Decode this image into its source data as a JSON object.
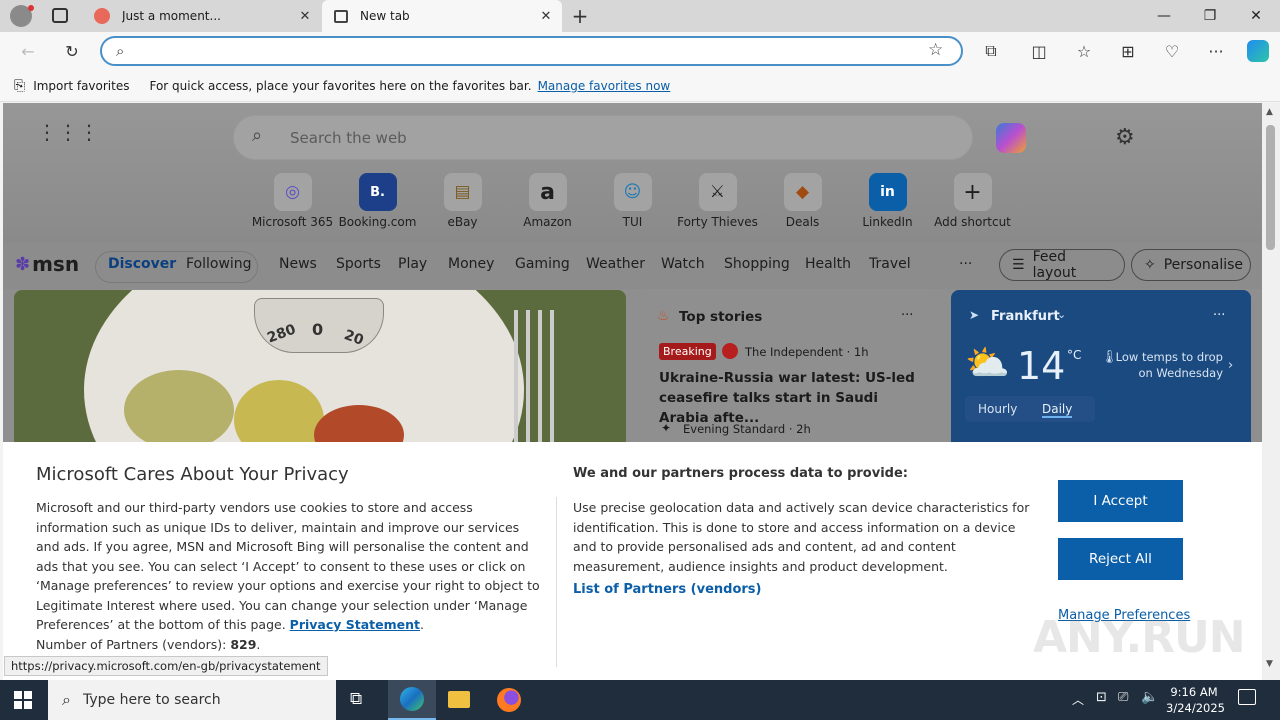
{
  "browser": {
    "tabs": [
      {
        "label": "Just a moment...",
        "active": false
      },
      {
        "label": "New tab",
        "active": true
      }
    ],
    "address_value": "",
    "favorites_bar": {
      "import_label": "Import favorites",
      "hint": "For quick access, place your favorites here on the favorites bar.",
      "manage_link": "Manage favorites now"
    }
  },
  "newtab": {
    "search_placeholder": "Search the web",
    "shortcuts": [
      {
        "label": "Microsoft 365",
        "glyph": "◎",
        "color": "#6b5bd6"
      },
      {
        "label": "Booking.com",
        "glyph": "B.",
        "color": "#1d3f8a"
      },
      {
        "label": "eBay",
        "glyph": "▤",
        "color": "#555555"
      },
      {
        "label": "Amazon",
        "glyph": "a",
        "color": "#111111"
      },
      {
        "label": "TUI",
        "glyph": "☺",
        "color": "#1a78b5"
      },
      {
        "label": "Forty Thieves",
        "glyph": "⚔",
        "color": "#222222"
      },
      {
        "label": "Deals",
        "glyph": "◆",
        "color": "#a04b12"
      },
      {
        "label": "LinkedIn",
        "glyph": "in",
        "color": "#0a5fa8"
      },
      {
        "label": "Add shortcut",
        "glyph": "+",
        "color": "#333333"
      }
    ],
    "msn": {
      "logo": "msn",
      "tabs": [
        "Discover",
        "Following"
      ],
      "nav": [
        "News",
        "Sports",
        "Play",
        "Money",
        "Gaming",
        "Weather",
        "Watch",
        "Shopping",
        "Health",
        "Travel"
      ],
      "more": "···",
      "feed_layout": "Feed layout",
      "personalise": "Personalise"
    },
    "hero": {
      "scale_numbers": [
        "280",
        "0",
        "20"
      ]
    },
    "top_stories": {
      "title": "Top stories",
      "more": "···",
      "badge": "Breaking",
      "source1": "The Independent · 1h",
      "headline": "Ukraine-Russia war latest: US-led ceasefire talks start in Saudi Arabia afte...",
      "source2": "Evening Standard · 2h"
    },
    "weather": {
      "city": "Frankfurt",
      "temp": "14",
      "unit": "°C",
      "note": "Low temps to drop on Wednesday",
      "tabs": [
        "Hourly",
        "Daily"
      ],
      "more": "···"
    }
  },
  "privacy": {
    "title": "Microsoft Cares About Your Privacy",
    "body": "Microsoft and our third-party vendors use cookies to store and access information such as unique IDs to deliver, maintain and improve our services and ads. If you agree, MSN and Microsoft Bing will personalise the content and ads that you see. You can select ‘I Accept’ to consent to these uses or click on ‘Manage preferences’ to review your options and exercise your right to object to Legitimate Interest where used.  You can change your selection under ‘Manage Preferences’ at the bottom of this page.",
    "privacy_link": "Privacy Statement",
    "partners_label": "Number of Partners (vendors):",
    "partners_count": "829",
    "right_title": "We and our partners process data to provide:",
    "right_body": "Use precise geolocation data and actively scan device characteristics for identification. This is done to store and access information on a device and to provide personalised ads and content, ad and content measurement, audience insights and product development.",
    "partners_link": "List of Partners (vendors)",
    "accept": "I Accept",
    "reject": "Reject All",
    "manage": "Manage Preferences"
  },
  "status_url": "https://privacy.microsoft.com/en-gb/privacystatement",
  "taskbar": {
    "search_placeholder": "Type here to search",
    "time": "9:16 AM",
    "date": "3/24/2025"
  },
  "watermark": "ANY.RUN"
}
